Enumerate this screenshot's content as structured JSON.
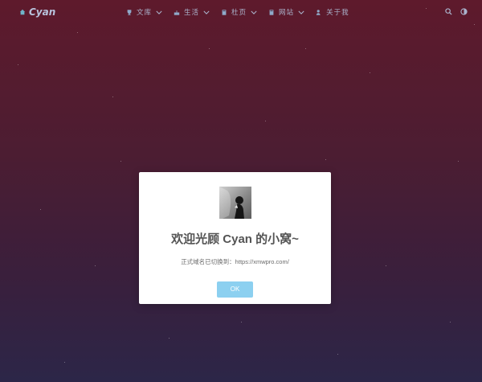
{
  "header": {
    "brand": "Cyan",
    "nav": [
      {
        "label": "文库",
        "icon": "trophy-icon",
        "has_dropdown": true
      },
      {
        "label": "生活",
        "icon": "cake-icon",
        "has_dropdown": true
      },
      {
        "label": "杜页",
        "icon": "book-icon",
        "has_dropdown": true
      },
      {
        "label": "网站",
        "icon": "book-icon",
        "has_dropdown": true
      },
      {
        "label": "关于我",
        "icon": "user-icon",
        "has_dropdown": false
      }
    ],
    "tools": [
      "search-icon",
      "theme-toggle-icon"
    ]
  },
  "dialog": {
    "title": "欢迎光顾 Cyan 的小窝~",
    "message": "正式域名已切换到：https://xmwpro.com/",
    "ok_label": "OK"
  },
  "colors": {
    "background_top": "#5e1a2c",
    "background_bottom": "#2c2648",
    "ok_button": "#8cd0f0"
  }
}
